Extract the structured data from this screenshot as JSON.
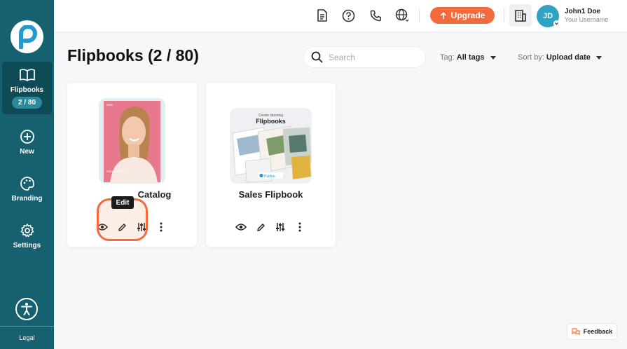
{
  "sidebar": {
    "items": [
      {
        "label": "Flipbooks",
        "count": "2 / 80",
        "icon": "book-icon"
      },
      {
        "label": "New",
        "icon": "plus-circle-icon"
      },
      {
        "label": "Branding",
        "icon": "palette-icon"
      },
      {
        "label": "Settings",
        "icon": "gear-icon"
      }
    ],
    "legal_label": "Legal"
  },
  "topbar": {
    "upgrade_label": "Upgrade",
    "user": {
      "initials": "JD",
      "name": "John1 Doe",
      "username": "Your Username"
    }
  },
  "page": {
    "title": "Flipbooks (2 / 80)",
    "search_placeholder": "Search",
    "tag_label": "Tag:",
    "tag_value": "All tags",
    "sort_label": "Sort by:",
    "sort_value": "Upload date"
  },
  "flipbooks": [
    {
      "title": "Catalog",
      "cover_text": "FEELING LIFE"
    },
    {
      "title": "Sales Flipbook",
      "cover_heading": "Create stunning",
      "cover_title": "Flipbooks",
      "cover_brand": "Publuu"
    }
  ],
  "tooltip": "Edit",
  "feedback_label": "Feedback",
  "colors": {
    "sidebar": "#17606f",
    "accent": "#f26a3d",
    "avatar": "#2fa3c3"
  }
}
